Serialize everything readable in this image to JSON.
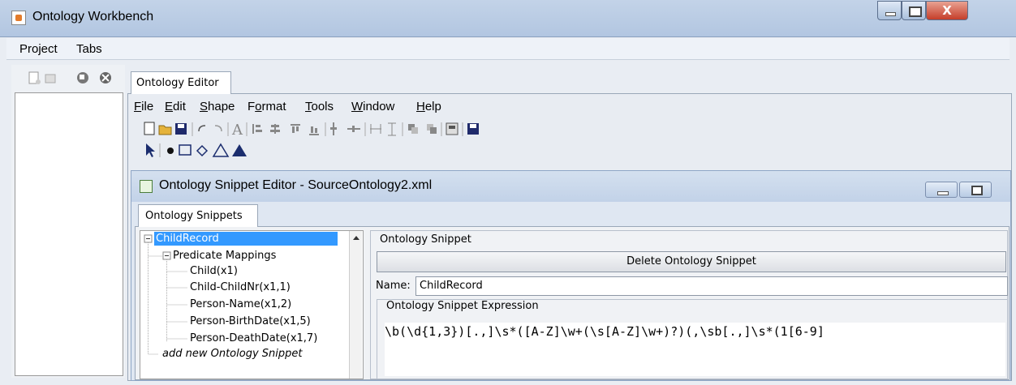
{
  "window": {
    "title": "Ontology Workbench",
    "close_glyph": "X"
  },
  "menubar": {
    "items": [
      "Project",
      "Tabs"
    ]
  },
  "left_toolbar": {
    "icons": [
      "new-file-icon",
      "open-icon",
      "save-icon",
      "close-circle-icon"
    ]
  },
  "tabs": {
    "editor": "Ontology Editor",
    "snippets": "Ontology Snippets"
  },
  "editor_menu": {
    "items": [
      {
        "label": "File",
        "mnemonic": "F",
        "rest": "ile"
      },
      {
        "label": "Edit",
        "mnemonic": "E",
        "rest": "dit"
      },
      {
        "label": "Shape",
        "mnemonic": "S",
        "rest": "hape"
      },
      {
        "label": "Format",
        "mnemonic": "o",
        "pre": "F",
        "rest": "rmat"
      },
      {
        "label": "Tools",
        "mnemonic": "T",
        "rest": "ools"
      },
      {
        "label": "Window",
        "mnemonic": "W",
        "rest": "indow"
      },
      {
        "label": "Help",
        "mnemonic": "H",
        "rest": "elp"
      }
    ]
  },
  "inner_window": {
    "title": "Ontology Snippet Editor - SourceOntology2.xml"
  },
  "tree": {
    "root": "ChildRecord",
    "group": "Predicate Mappings",
    "children": [
      "Child(x1)",
      "Child-ChildNr(x1,1)",
      "Person-Name(x1,2)",
      "Person-BirthDate(x1,5)",
      "Person-DeathDate(x1,7)"
    ],
    "add_new": "add new Ontology Snippet"
  },
  "snippet": {
    "section_label": "Ontology Snippet",
    "delete_button": "Delete Ontology Snippet",
    "name_label": "Name:",
    "name_value": "ChildRecord",
    "expression_label": "Ontology Snippet Expression",
    "expression": "\\b(\\d{1,3})[.,]\\s*([A-Z]\\w+(\\s[A-Z]\\w+)?)(,\\sb[.,]\\s*(1[6-9]"
  },
  "colors": {
    "selection": "#3399ff",
    "accent_toolbar_triangle": "#1b2d6e"
  }
}
